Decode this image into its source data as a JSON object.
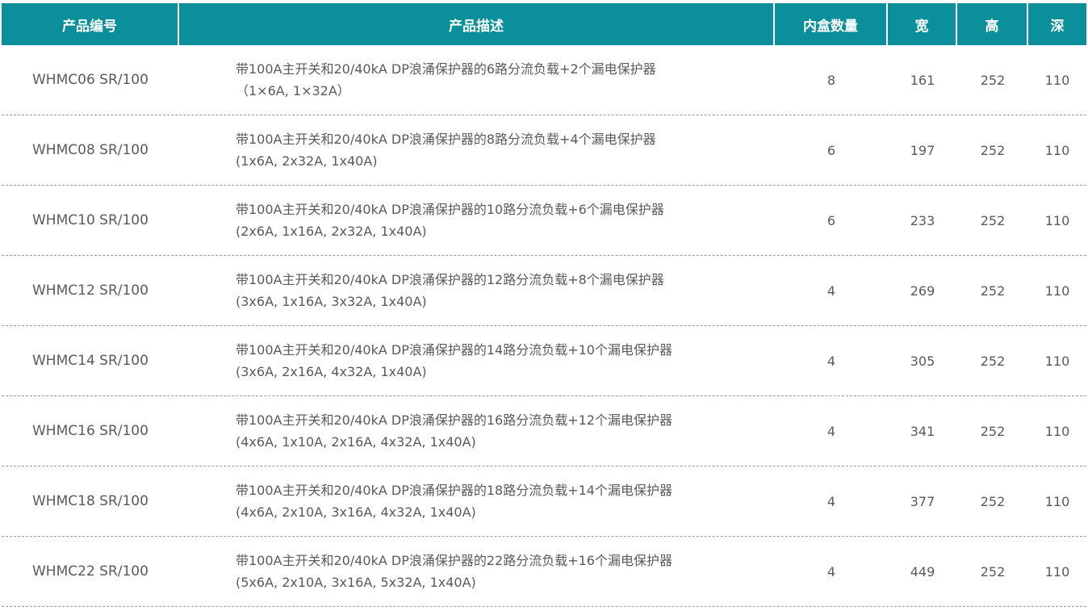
{
  "headers": {
    "code": "产品编号",
    "desc": "产品描述",
    "qty": "内盒数量",
    "width": "宽",
    "height": "高",
    "depth": "深"
  },
  "rows": [
    {
      "code": "WHMC06 SR/100",
      "desc1": "带100A主开关和20/40kA DP浪涌保护器的6路分流负载+2个漏电保护器",
      "desc2": "（1×6A, 1×32A）",
      "qty": "8",
      "w": "161",
      "h": "252",
      "d": "110"
    },
    {
      "code": "WHMC08 SR/100",
      "desc1": "带100A主开关和20/40kA DP浪涌保护器的8路分流负载+4个漏电保护器",
      "desc2": "(1x6A, 2x32A, 1x40A)",
      "qty": "6",
      "w": "197",
      "h": "252",
      "d": "110"
    },
    {
      "code": "WHMC10 SR/100",
      "desc1": "带100A主开关和20/40kA DP浪涌保护器的10路分流负载+6个漏电保护器",
      "desc2": "(2x6A, 1x16A, 2x32A, 1x40A)",
      "qty": "6",
      "w": "233",
      "h": "252",
      "d": "110"
    },
    {
      "code": "WHMC12 SR/100",
      "desc1": "带100A主开关和20/40kA DP浪涌保护器的12路分流负载+8个漏电保护器",
      "desc2": "(3x6A, 1x16A, 3x32A, 1x40A)",
      "qty": "4",
      "w": "269",
      "h": "252",
      "d": "110"
    },
    {
      "code": "WHMC14 SR/100",
      "desc1": "带100A主开关和20/40kA DP浪涌保护器的14路分流负载+10个漏电保护器",
      "desc2": "(3x6A, 2x16A, 4x32A, 1x40A)",
      "qty": "4",
      "w": "305",
      "h": "252",
      "d": "110"
    },
    {
      "code": "WHMC16 SR/100",
      "desc1": "带100A主开关和20/40kA DP浪涌保护器的16路分流负载+12个漏电保护器",
      "desc2": "(4x6A, 1x10A, 2x16A, 4x32A, 1x40A)",
      "qty": "4",
      "w": "341",
      "h": "252",
      "d": "110"
    },
    {
      "code": "WHMC18 SR/100",
      "desc1": "带100A主开关和20/40kA DP浪涌保护器的18路分流负载+14个漏电保护器",
      "desc2": "(4x6A, 2x10A, 3x16A, 4x32A, 1x40A)",
      "qty": "4",
      "w": "377",
      "h": "252",
      "d": "110"
    },
    {
      "code": "WHMC22 SR/100",
      "desc1": "带100A主开关和20/40kA DP浪涌保护器的22路分流负载+16个漏电保护器",
      "desc2": "(5x6A, 2x10A, 3x16A, 5x32A, 1x40A)",
      "qty": "4",
      "w": "449",
      "h": "252",
      "d": "110"
    }
  ],
  "colors": {
    "header_bg": "#0b8f9a",
    "header_text": "#ffffff",
    "body_text": "#5a5a5a",
    "divider": "#9a9a9a"
  }
}
